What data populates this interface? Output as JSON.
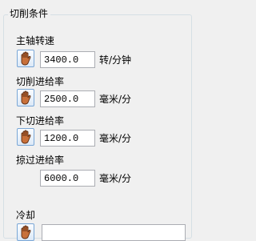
{
  "group": {
    "title": "切削条件"
  },
  "rows": [
    {
      "label": "主轴转速",
      "value": "3400.0",
      "unit": "转/分钟"
    },
    {
      "label": "切削进给率",
      "value": "2500.0",
      "unit": "毫米/分"
    },
    {
      "label": "下切进给率",
      "value": "1200.0",
      "unit": "毫米/分"
    },
    {
      "label": "掠过进给率",
      "value": "6000.0",
      "unit": "毫米/分"
    }
  ],
  "cooling": {
    "label": "冷却"
  },
  "icons": {
    "hand": "hand-icon"
  }
}
